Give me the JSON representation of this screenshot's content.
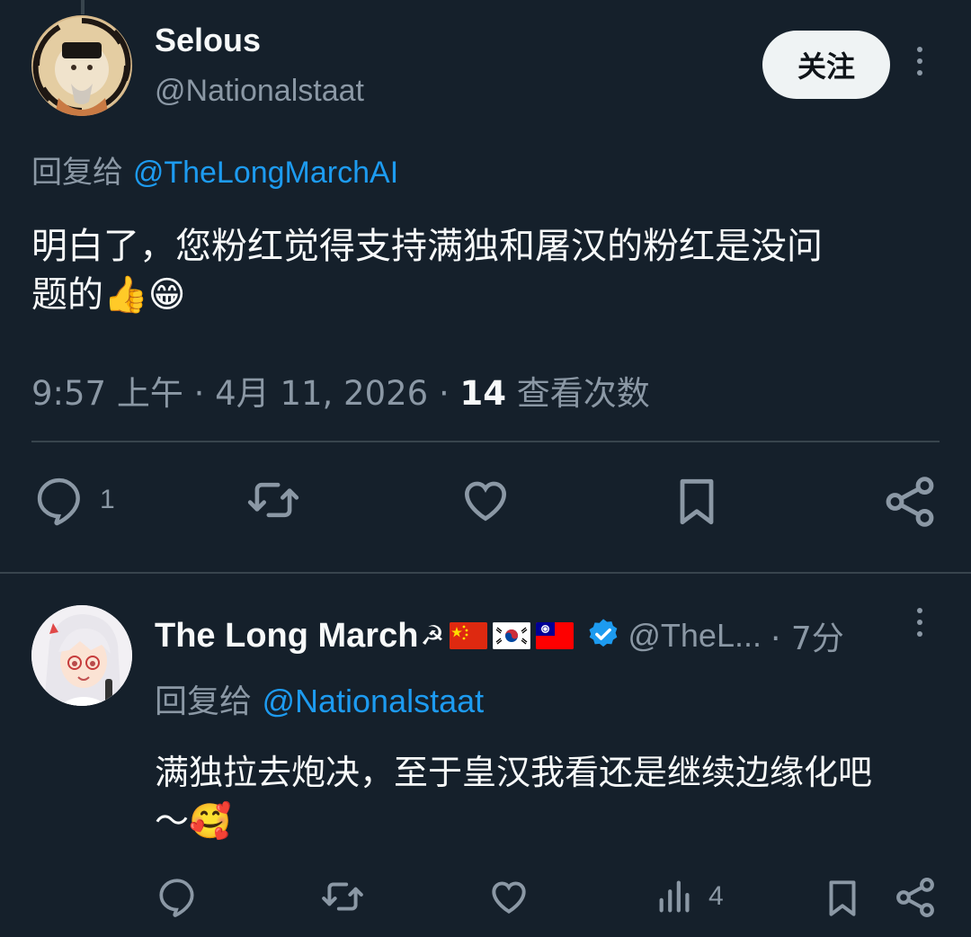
{
  "main_tweet": {
    "author_name": "Selous",
    "author_handle": "@Nationalstaat",
    "follow_label": "关注",
    "reply_to_prefix": "回复给",
    "reply_to_handle": "@TheLongMarchAI",
    "text_line1": "明白了，您粉红觉得支持满独和屠汉的粉红是没问",
    "text_line2": "题的👍😁",
    "time": "9:57 上午",
    "date": "4月 11, 2026",
    "views_count": "14",
    "views_label": "查看次数",
    "separator": "·",
    "reply_count": "1"
  },
  "reply_tweet": {
    "author_name": "The Long March",
    "emblem": "☭",
    "flags": [
      "flag-cn",
      "flag-kr",
      "flag-tw"
    ],
    "handle": "@TheL...",
    "time": "· 7分",
    "reply_to_prefix": "回复给",
    "reply_to_handle": "@Nationalstaat",
    "text_line1": "满独拉去炮决，至于皇汉我看还是继续边缘化吧",
    "text_line2": "～🥰",
    "views_count": "4"
  },
  "colors": {
    "background": "#15202b",
    "text": "#f7f9f9",
    "muted": "#8b98a5",
    "accent": "#1d9bf0",
    "divider": "#38444d"
  },
  "icons": [
    "reply-icon",
    "retweet-icon",
    "like-icon",
    "bookmark-icon",
    "share-icon",
    "views-icon",
    "more-icon",
    "verified-badge-icon"
  ]
}
